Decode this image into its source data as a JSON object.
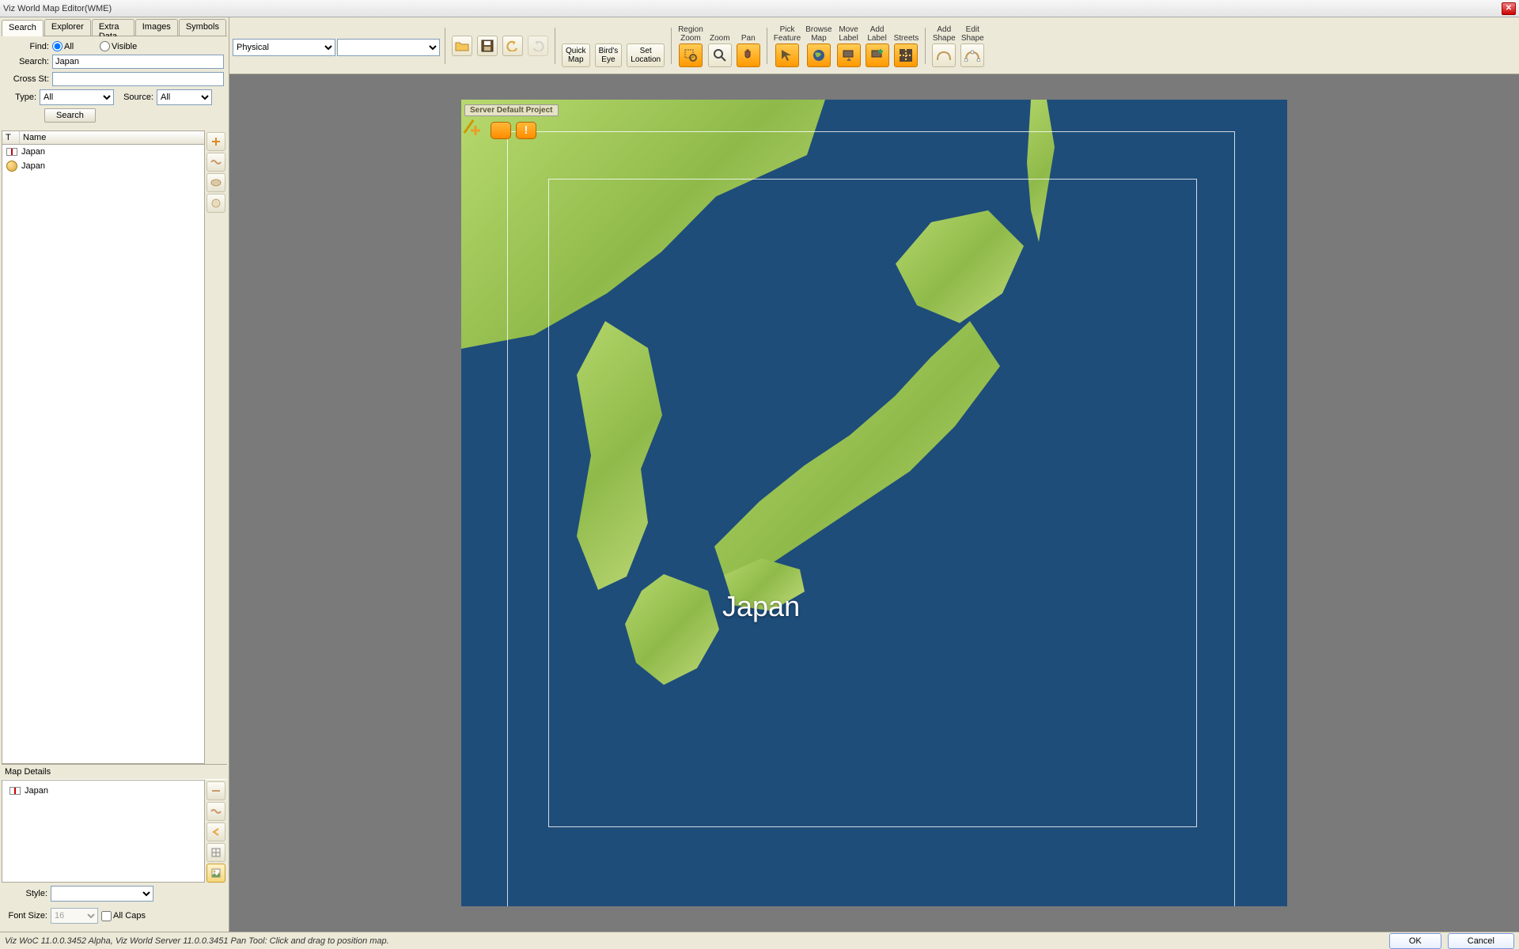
{
  "window": {
    "title": "Viz World Map Editor(WME)"
  },
  "sidebar": {
    "tabs": [
      "Search",
      "Explorer",
      "Extra Data",
      "Images",
      "Symbols"
    ],
    "active_tab": 0,
    "find_label": "Find:",
    "find_all": "All",
    "find_visible": "Visible",
    "search_label": "Search:",
    "search_value": "Japan",
    "cross_st_label": "Cross St:",
    "cross_st_value": "",
    "type_label": "Type:",
    "type_value": "All",
    "source_label": "Source:",
    "source_value": "All",
    "search_btn": "Search",
    "col_t": "T",
    "col_name": "Name",
    "results": [
      {
        "icon": "flag",
        "name": "Japan"
      },
      {
        "icon": "globe",
        "name": "Japan"
      }
    ],
    "map_details_label": "Map Details",
    "map_details_item": "Japan",
    "style_label": "Style:",
    "style_value": "",
    "font_size_label": "Font Size:",
    "font_size_value": "16",
    "all_caps_label": "All Caps"
  },
  "toolbar": {
    "style_select": "Physical",
    "second_select": "",
    "buttons": {
      "open": "",
      "save": "",
      "undo": "",
      "redo": "",
      "quick_map": "Quick\nMap",
      "birds_eye": "Bird's\nEye",
      "set_location": "Set\nLocation",
      "region_zoom": "Region\nZoom",
      "zoom": "Zoom",
      "pan": "Pan",
      "pick_feature": "Pick\nFeature",
      "browse_map": "Browse\nMap",
      "move_label": "Move\nLabel",
      "add_label": "Add\nLabel",
      "streets": "Streets",
      "add_shape": "Add\nShape",
      "edit_shape": "Edit\nShape"
    }
  },
  "map": {
    "project_label": "Server Default Project",
    "center_label": "Japan"
  },
  "status": {
    "text": "Viz WoC 11.0.0.3452 Alpha, Viz World Server 11.0.0.3451 Pan Tool: Click and drag to position map.",
    "ok": "OK",
    "cancel": "Cancel"
  }
}
